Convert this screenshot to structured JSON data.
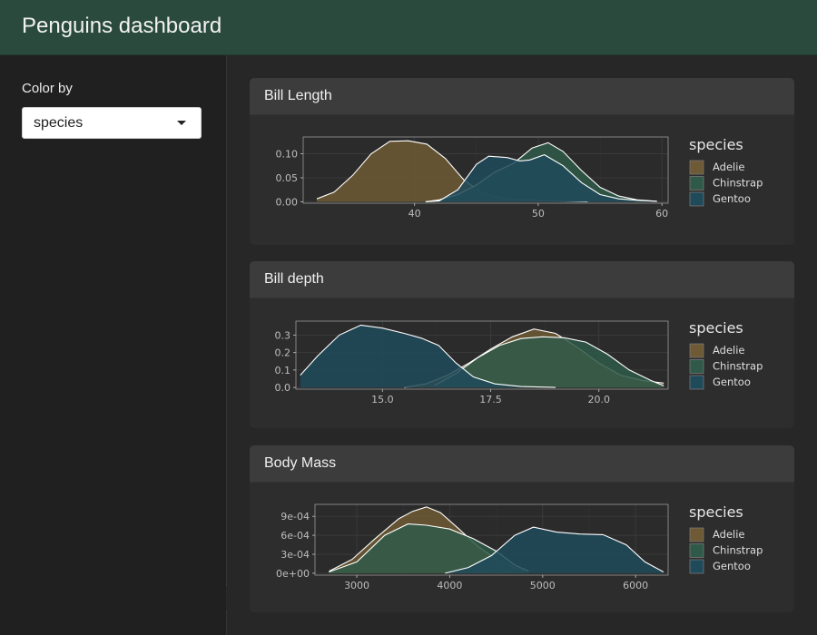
{
  "app": {
    "title": "Penguins dashboard"
  },
  "sidebar": {
    "color_label": "Color by",
    "color_select": {
      "value": "species",
      "options": [
        "species"
      ]
    },
    "collapse_icon": "chevron-left-icon"
  },
  "colors": {
    "Adelie": "#6e5a34",
    "Chinstrap": "#2f5a49",
    "Gentoo": "#1f4a5a"
  },
  "cards": [
    {
      "title": "Bill Length"
    },
    {
      "title": "Bill depth"
    },
    {
      "title": "Body Mass"
    }
  ],
  "chart_data": [
    {
      "type": "area",
      "title": "Bill Length",
      "xlim": [
        31,
        60.5
      ],
      "ylim": [
        -0.003,
        0.135
      ],
      "xticks": [
        40,
        50,
        60
      ],
      "xtick_labels": [
        "40",
        "50",
        "60"
      ],
      "yticks": [
        0,
        0.05,
        0.1
      ],
      "ytick_labels": [
        "0.00",
        "0.05",
        "0.10"
      ],
      "legend": {
        "title": "species",
        "entries": [
          "Adelie",
          "Chinstrap",
          "Gentoo"
        ],
        "position": "right"
      },
      "series": [
        {
          "name": "Adelie",
          "points": [
            [
              32.1,
              0.006
            ],
            [
              33.5,
              0.02
            ],
            [
              35,
              0.055
            ],
            [
              36.5,
              0.1
            ],
            [
              38,
              0.126
            ],
            [
              39.5,
              0.127
            ],
            [
              41,
              0.12
            ],
            [
              42.5,
              0.09
            ],
            [
              44,
              0.045
            ],
            [
              45.5,
              0.018
            ],
            [
              47,
              0.008
            ],
            [
              48.5,
              0.005
            ],
            [
              50,
              0.003
            ],
            [
              52,
              0.001
            ],
            [
              54,
              0
            ]
          ]
        },
        {
          "name": "Chinstrap",
          "points": [
            [
              40.9,
              0
            ],
            [
              42,
              0.004
            ],
            [
              43.5,
              0.015
            ],
            [
              45,
              0.035
            ],
            [
              46.5,
              0.062
            ],
            [
              48,
              0.08
            ],
            [
              49.5,
              0.112
            ],
            [
              50.8,
              0.123
            ],
            [
              52,
              0.105
            ],
            [
              53.5,
              0.065
            ],
            [
              55,
              0.03
            ],
            [
              56.5,
              0.012
            ],
            [
              58,
              0.004
            ],
            [
              59.6,
              0.001
            ]
          ]
        },
        {
          "name": "Gentoo",
          "points": [
            [
              40.9,
              0
            ],
            [
              42,
              0.002
            ],
            [
              43.5,
              0.025
            ],
            [
              45,
              0.078
            ],
            [
              46,
              0.095
            ],
            [
              47.5,
              0.092
            ],
            [
              48.5,
              0.085
            ],
            [
              49.3,
              0.087
            ],
            [
              50.5,
              0.098
            ],
            [
              52,
              0.075
            ],
            [
              53.5,
              0.04
            ],
            [
              55,
              0.015
            ],
            [
              56.5,
              0.006
            ],
            [
              58,
              0.003
            ],
            [
              59.6,
              0.001
            ]
          ]
        }
      ]
    },
    {
      "type": "area",
      "title": "Bill depth",
      "xlim": [
        13,
        21.6
      ],
      "ylim": [
        -0.01,
        0.38
      ],
      "xticks": [
        15,
        17.5,
        20
      ],
      "xtick_labels": [
        "15.0",
        "17.5",
        "20.0"
      ],
      "yticks": [
        0,
        0.1,
        0.2,
        0.3
      ],
      "ytick_labels": [
        "0.0",
        "0.1",
        "0.2",
        "0.3"
      ],
      "legend": {
        "title": "species",
        "entries": [
          "Adelie",
          "Chinstrap",
          "Gentoo"
        ],
        "position": "right"
      },
      "series": [
        {
          "name": "Adelie",
          "points": [
            [
              15.5,
              0
            ],
            [
              16,
              0.02
            ],
            [
              16.5,
              0.07
            ],
            [
              17,
              0.14
            ],
            [
              17.5,
              0.22
            ],
            [
              18,
              0.29
            ],
            [
              18.5,
              0.335
            ],
            [
              19,
              0.31
            ],
            [
              19.5,
              0.23
            ],
            [
              20,
              0.14
            ],
            [
              20.5,
              0.07
            ],
            [
              21,
              0.04
            ],
            [
              21.5,
              0.025
            ]
          ]
        },
        {
          "name": "Chinstrap",
          "points": [
            [
              16.2,
              0.01
            ],
            [
              16.7,
              0.08
            ],
            [
              17.2,
              0.17
            ],
            [
              17.7,
              0.24
            ],
            [
              18.2,
              0.28
            ],
            [
              18.7,
              0.29
            ],
            [
              19.2,
              0.285
            ],
            [
              19.7,
              0.26
            ],
            [
              20.2,
              0.19
            ],
            [
              20.7,
              0.1
            ],
            [
              21.2,
              0.04
            ],
            [
              21.5,
              0.01
            ]
          ]
        },
        {
          "name": "Gentoo",
          "points": [
            [
              13.1,
              0.07
            ],
            [
              13.5,
              0.18
            ],
            [
              14,
              0.3
            ],
            [
              14.5,
              0.357
            ],
            [
              15,
              0.34
            ],
            [
              15.5,
              0.31
            ],
            [
              15.9,
              0.282
            ],
            [
              16.3,
              0.24
            ],
            [
              16.7,
              0.14
            ],
            [
              17.1,
              0.06
            ],
            [
              17.6,
              0.02
            ],
            [
              18.2,
              0.005
            ],
            [
              19,
              0
            ]
          ]
        }
      ]
    },
    {
      "type": "area",
      "title": "Body Mass",
      "xlim": [
        2550,
        6350
      ],
      "ylim": [
        -3e-05,
        0.00109
      ],
      "xticks": [
        3000,
        4000,
        5000,
        6000
      ],
      "xtick_labels": [
        "3000",
        "4000",
        "5000",
        "6000"
      ],
      "yticks": [
        0,
        0.0003,
        0.0006,
        0.0009
      ],
      "ytick_labels": [
        "0e+00",
        "3e-04",
        "6e-04",
        "9e-04"
      ],
      "legend": {
        "title": "species",
        "entries": [
          "Adelie",
          "Chinstrap",
          "Gentoo"
        ],
        "position": "right"
      },
      "series": [
        {
          "name": "Adelie",
          "points": [
            [
              2700,
              3e-05
            ],
            [
              2950,
              0.00022
            ],
            [
              3200,
              0.00055
            ],
            [
              3450,
              0.00086
            ],
            [
              3600,
              0.00098
            ],
            [
              3750,
              0.00105
            ],
            [
              3900,
              0.00096
            ],
            [
              4100,
              0.0007
            ],
            [
              4300,
              0.00043
            ],
            [
              4500,
              0.00022
            ],
            [
              4700,
              8e-05
            ],
            [
              4800,
              3e-05
            ]
          ]
        },
        {
          "name": "Chinstrap",
          "points": [
            [
              2700,
              2e-05
            ],
            [
              3000,
              0.00018
            ],
            [
              3300,
              0.0006
            ],
            [
              3550,
              0.00078
            ],
            [
              3750,
              0.00076
            ],
            [
              4000,
              0.0007
            ],
            [
              4250,
              0.00055
            ],
            [
              4500,
              0.00035
            ],
            [
              4700,
              0.00013
            ],
            [
              4850,
              3e-05
            ]
          ]
        },
        {
          "name": "Gentoo",
          "points": [
            [
              3950,
              0
            ],
            [
              4200,
              9e-05
            ],
            [
              4450,
              0.00028
            ],
            [
              4700,
              0.0006
            ],
            [
              4900,
              0.00073
            ],
            [
              5150,
              0.00065
            ],
            [
              5400,
              0.00062
            ],
            [
              5650,
              0.00061
            ],
            [
              5900,
              0.00045
            ],
            [
              6100,
              0.00018
            ],
            [
              6300,
              2e-05
            ]
          ]
        }
      ]
    }
  ]
}
